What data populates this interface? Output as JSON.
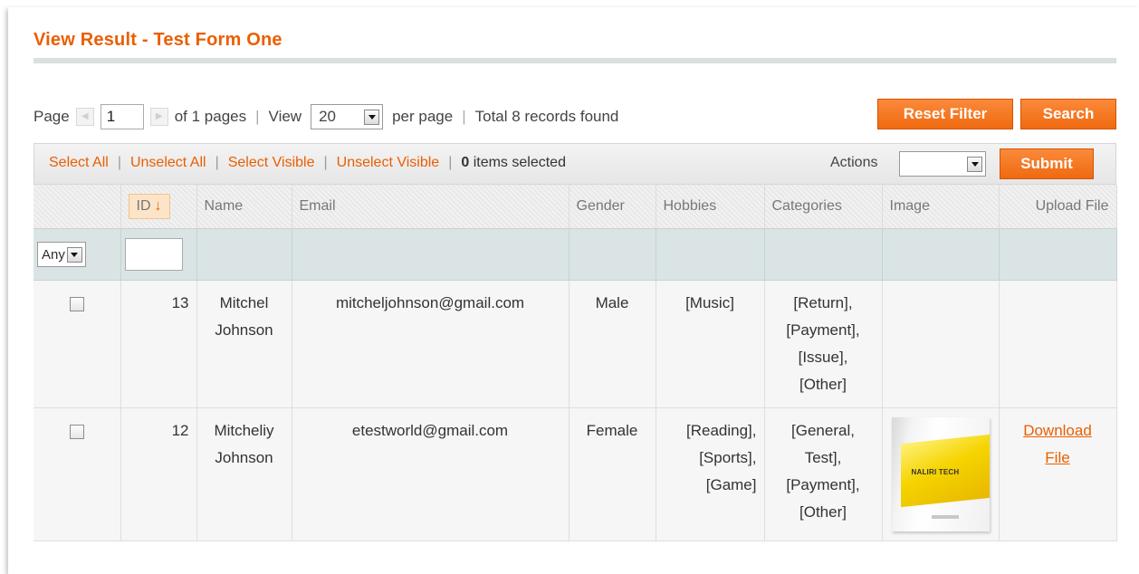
{
  "page_title": "View Result - Test Form One",
  "pager": {
    "page_label": "Page",
    "page_value": "1",
    "of_pages": "of 1 pages",
    "view_label": "View",
    "per_page_value": "20",
    "per_page_label": "per page",
    "total": "Total 8 records found"
  },
  "buttons": {
    "reset_filter": "Reset Filter",
    "search": "Search",
    "submit": "Submit"
  },
  "massaction": {
    "select_all": "Select All",
    "unselect_all": "Unselect All",
    "select_visible": "Select Visible",
    "unselect_visible": "Unselect Visible",
    "selected_count": "0",
    "selected_suffix": "items selected",
    "actions_label": "Actions"
  },
  "columns": {
    "id": "ID",
    "name": "Name",
    "email": "Email",
    "gender": "Gender",
    "hobbies": "Hobbies",
    "categories": "Categories",
    "image": "Image",
    "upload_file": "Upload File"
  },
  "filter": {
    "massaction_select": "Any"
  },
  "rows": [
    {
      "id": "13",
      "name_line1": "Mitchel",
      "name_line2": "Johnson",
      "email": "mitcheljohnson@gmail.com",
      "gender": "Male",
      "hobbies": [
        "[Music]"
      ],
      "categories": [
        "[Return],",
        "[Payment],",
        "[Issue],",
        "[Other]"
      ],
      "has_image": false,
      "upload": ""
    },
    {
      "id": "12",
      "name_line1": "Mitcheliy",
      "name_line2": "Johnson",
      "email": "etestworld@gmail.com",
      "gender": "Female",
      "hobbies": [
        "[Reading],",
        "[Sports],",
        "[Game]"
      ],
      "categories": [
        "[General,",
        "Test],",
        "[Payment],",
        "[Other]"
      ],
      "has_image": true,
      "image_logo_text": "NALIRI TECH",
      "upload_line1": "Download",
      "upload_line2": "File"
    }
  ],
  "colors": {
    "accent": "#eb5e00",
    "button": "#f37a22",
    "filter_row": "#dae4e5",
    "row_bg": "#f6f6f6"
  }
}
